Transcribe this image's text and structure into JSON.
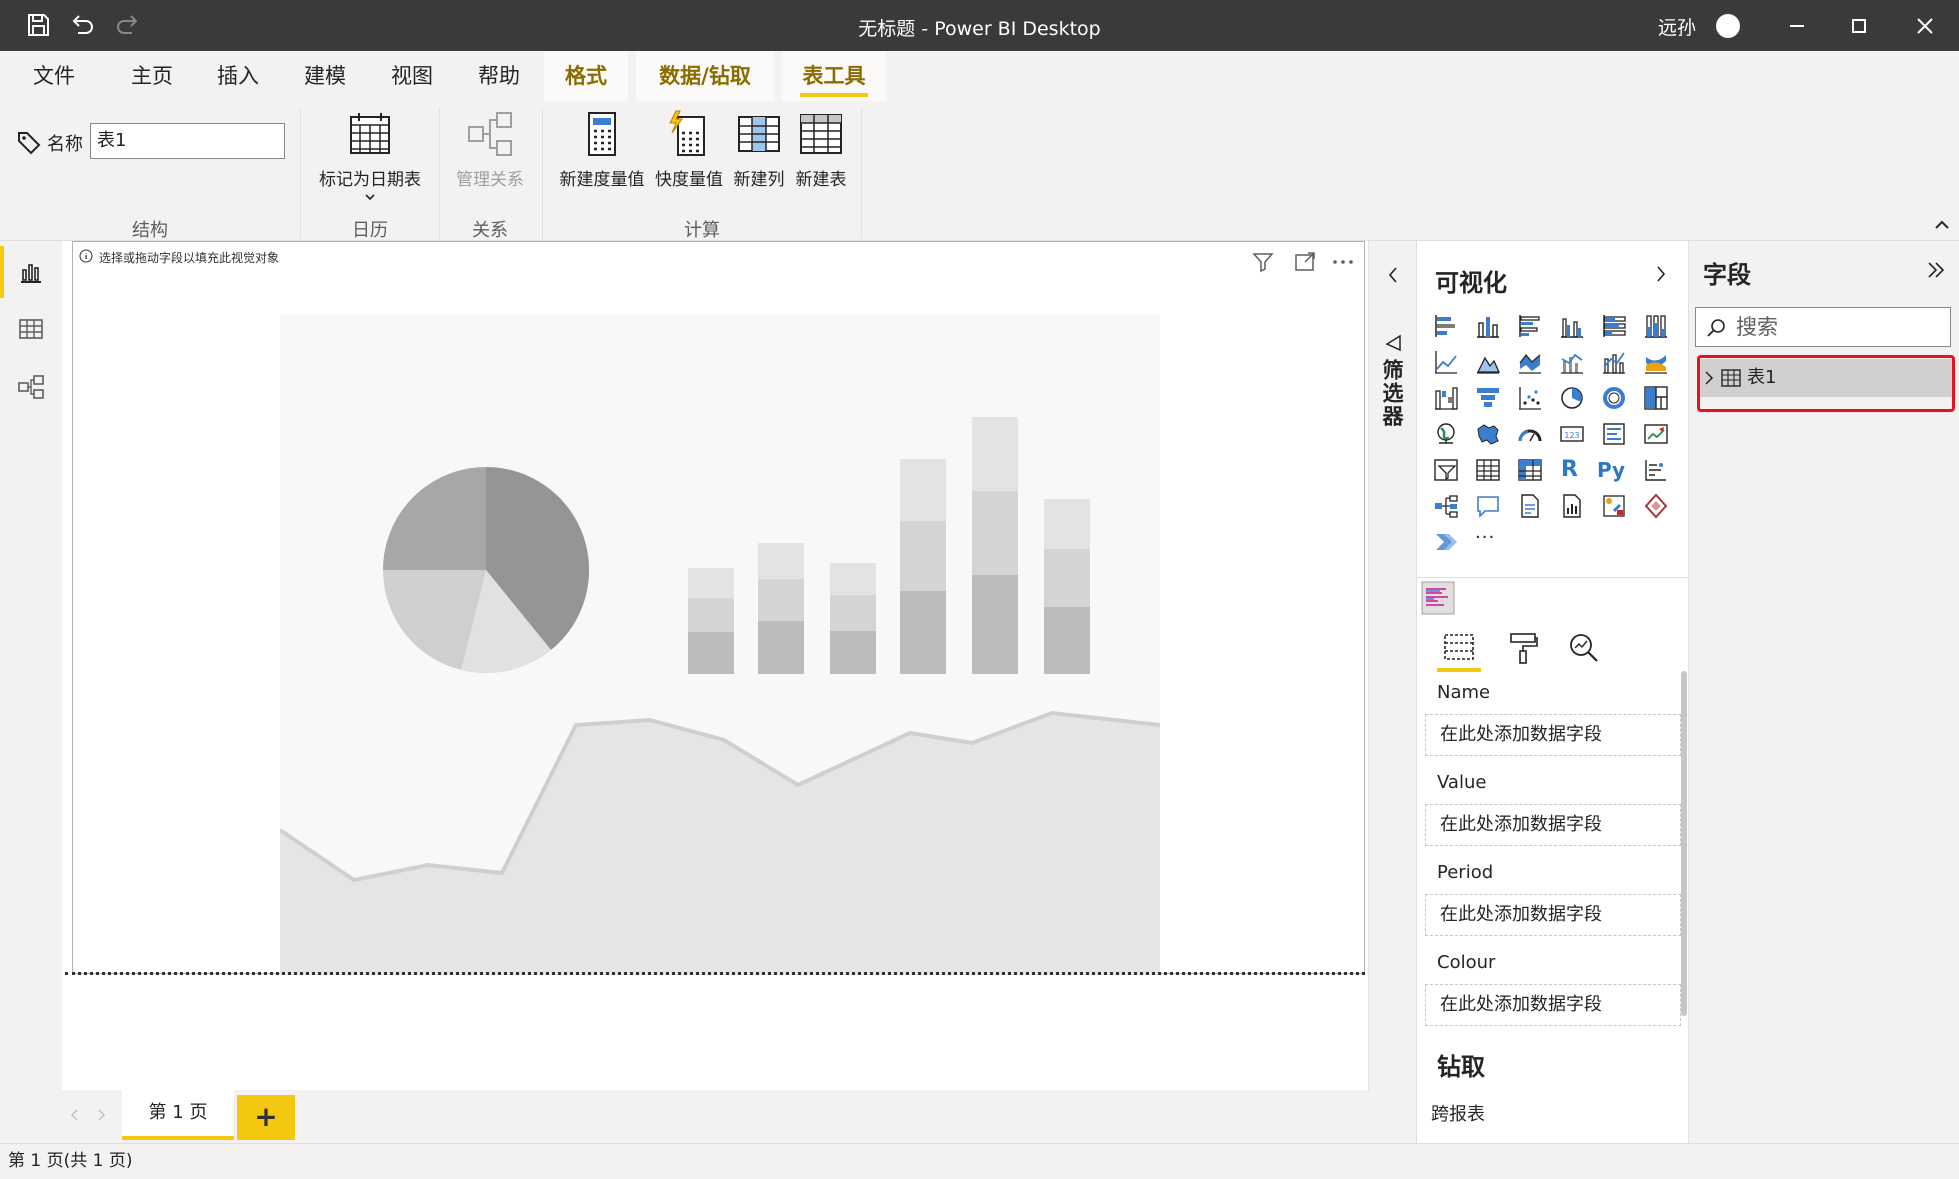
{
  "window": {
    "title": "无标题 - Power BI Desktop",
    "user": "远孙"
  },
  "ribbon_tabs": [
    {
      "label": "文件"
    },
    {
      "label": "主页"
    },
    {
      "label": "插入"
    },
    {
      "label": "建模"
    },
    {
      "label": "视图"
    },
    {
      "label": "帮助"
    },
    {
      "label": "格式"
    },
    {
      "label": "数据/钻取"
    },
    {
      "label": "表工具"
    }
  ],
  "ribbon": {
    "name_label": "名称",
    "name_value": "表1",
    "mark_date_table": "标记为日期表",
    "manage_relationships": "管理关系",
    "new_measure": "新建度量值",
    "quick_measure": "快度量值",
    "new_column": "新建列",
    "new_table": "新建表",
    "groups": {
      "structure": "结构",
      "calendar": "日历",
      "relationships": "关系",
      "calculations": "计算"
    }
  },
  "canvas": {
    "hint": "选择或拖动字段以填充此视觉对象"
  },
  "pages": {
    "current_tab": "第 1 页",
    "add": "+",
    "status": "第 1 页(共 1 页)"
  },
  "filters": {
    "label": "筛选器"
  },
  "visualizations": {
    "title": "可视化",
    "wells": [
      {
        "label": "Name",
        "placeholder": "在此处添加数据字段"
      },
      {
        "label": "Value",
        "placeholder": "在此处添加数据字段"
      },
      {
        "label": "Period",
        "placeholder": "在此处添加数据字段"
      },
      {
        "label": "Colour",
        "placeholder": "在此处添加数据字段"
      }
    ],
    "drill_title": "钻取",
    "cross_report": "跨报表",
    "r_label": "R",
    "py_label": "Py",
    "more": "···"
  },
  "fields": {
    "title": "字段",
    "search_placeholder": "搜索",
    "tables": [
      {
        "name": "表1"
      }
    ]
  },
  "colors": {
    "accent": "#f2c811",
    "highlight": "#e81123",
    "titlebar": "#3b3a39"
  }
}
